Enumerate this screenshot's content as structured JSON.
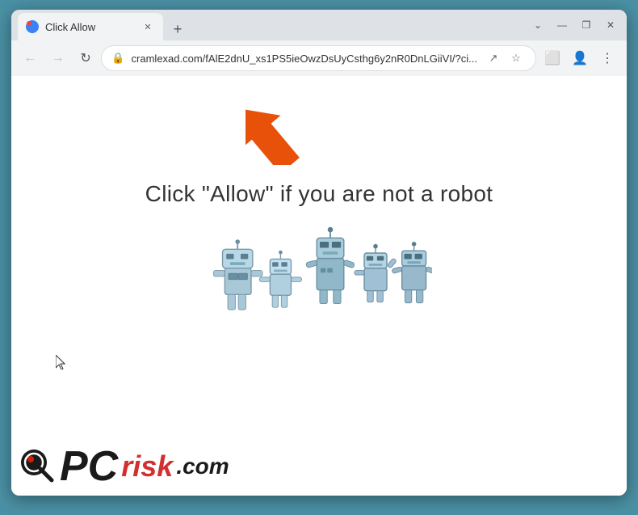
{
  "browser": {
    "tab": {
      "title": "Click Allow",
      "favicon_color": "#3b82f6"
    },
    "window_controls": {
      "minimize": "—",
      "maximize": "❐",
      "close": "✕"
    },
    "address_bar": {
      "url": "cramlexad.com/fAlE2dnU_xs1PS5ieOwzDsUyCsthg6y2nR0DnLGiiVI/?ci...",
      "lock_icon": "🔒"
    },
    "nav": {
      "back": "←",
      "forward": "→",
      "refresh": "↻"
    }
  },
  "content": {
    "main_text": "Click \"Allow\"   if you are not   a robot",
    "arrow_label": "arrow pointing to address bar"
  },
  "watermark": {
    "pc_text": "PC",
    "risk_text": "risk",
    "com_text": ".com"
  }
}
